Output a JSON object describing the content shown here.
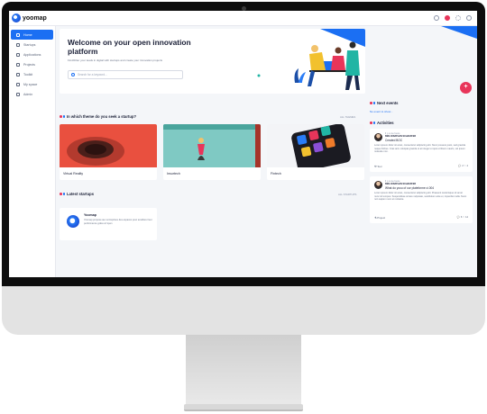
{
  "app": {
    "logo_text": "yoomap"
  },
  "topbar": {
    "icons": [
      "search-icon",
      "notification-icon",
      "settings-icon",
      "user-icon"
    ]
  },
  "sidebar": {
    "items": [
      {
        "label": "Home",
        "icon": "home-icon"
      },
      {
        "label": "Startups",
        "icon": "rocket-icon"
      },
      {
        "label": "Applications",
        "icon": "mail-icon"
      },
      {
        "label": "Projects",
        "icon": "flask-icon"
      },
      {
        "label": "Toolkit",
        "icon": "tools-icon"
      },
      {
        "label": "My space",
        "icon": "user-icon"
      },
      {
        "label": "Admin",
        "icon": "gear-icon"
      }
    ]
  },
  "hero": {
    "title": "Welcome on your open innovation platform",
    "subtitle": "Find/Filter your leads in digital with startups and create your innovation projects",
    "search_placeholder": "Search for a keyword..."
  },
  "themes": {
    "title": "In which theme do you seek a startup?",
    "link": "ALL THEMES",
    "cards": [
      {
        "label": "Virtual Reality"
      },
      {
        "label": "Insurtech"
      },
      {
        "label": "Fintech"
      }
    ]
  },
  "latest": {
    "title": "Latest startups",
    "link": "ALL STARTUPS",
    "startup": {
      "name": "Yoomap",
      "description": "Yoomap propose aux entreprises des espaces pour améliorer leur performance grâce à l'open"
    }
  },
  "events": {
    "title": "Next events",
    "empty": "No event to show..."
  },
  "activities": {
    "title": "Activities",
    "items": [
      {
        "time": "Il y a une heure",
        "author": "BEN JONATHAN SCHAEFFER",
        "subject": "Created BOC",
        "body": "Lorem ipsum dolor sit amet, consectetur adipiscing elit. Nunc posuere justo, sed gravida neque finibus. Cras arcu volutpat gravida ut at integer et quis ut libero mauris, vel ipsum molestie non.",
        "tag": "Tool",
        "comments": "2",
        "likes": "4"
      },
      {
        "time": "Il y a une heure",
        "author": "BEN JONATHAN SCHAEFFER",
        "subject": "What do yoou of our plateforme ci.004",
        "body": "Lorem ipsum dolor sit amet, consectetur adipiscing elit. Praesent scelerisque sit amet nunc sit tempus. Suspendisse ornare vulputate, vestibulum ante et, imperdiet nulla. Nunc non sapien nunc et molestie.",
        "tag": "Project",
        "comments": "6",
        "likes": "14"
      }
    ]
  },
  "fab": {
    "label": "+"
  },
  "colors": {
    "accent": "#1b6ff3",
    "brand_pink": "#e8355a"
  }
}
